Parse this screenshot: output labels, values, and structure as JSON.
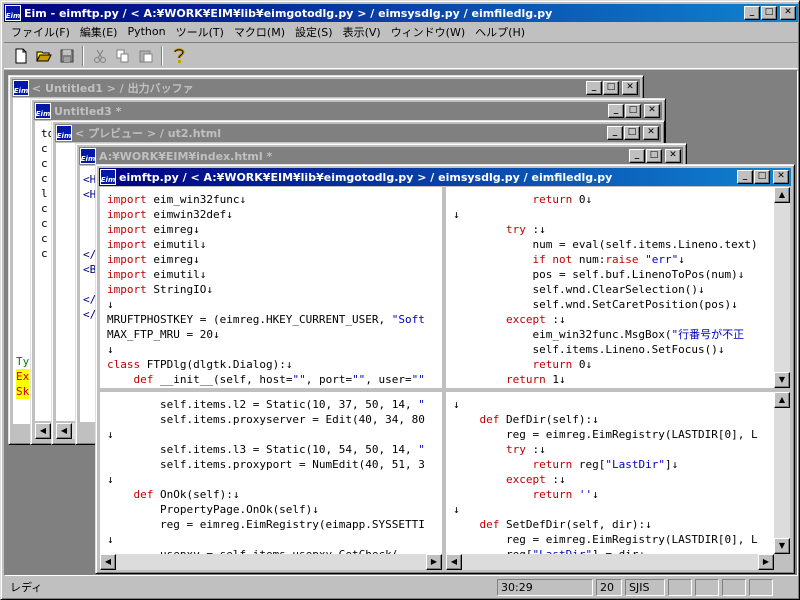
{
  "app": {
    "title": "Eim - eimftp.py / < A:¥WORK¥EIM¥lib¥eimgotodlg.py > / eimsysdlg.py / eimfiledlg.py",
    "icon": "Eim"
  },
  "menu": [
    "ファイル(F)",
    "編集(E)",
    "Python",
    "ツール(T)",
    "マクロ(M)",
    "設定(S)",
    "表示(V)",
    "ウィンドウ(W)",
    "ヘルプ(H)"
  ],
  "toolbar": {
    "icons": [
      "new-file-icon",
      "open-folder-icon",
      "save-icon",
      "cut-icon",
      "copy-icon",
      "paste-icon",
      "help-icon"
    ]
  },
  "windows": {
    "w1": "< Untitled1 > / 出力バッファ",
    "w2": "Untitled3 *",
    "w3": "< プレビュー > / ut2.html",
    "w4": "A:¥WORK¥EIM¥index.html *",
    "w5": "eimftp.py / < A:¥WORK¥EIM¥lib¥eimgotodlg.py > / eimsysdlg.py / eimfiledlg.py"
  },
  "bg_text": {
    "w1_lines": [
      "Ty",
      "Ex",
      "Sk"
    ],
    "w2_lines": [
      "to",
      "c",
      "c",
      "c",
      "l",
      "c",
      "c",
      "c",
      "c"
    ],
    "w4_lines": [
      "<H",
      "<H",
      "",
      "",
      "",
      "</",
      "<B",
      "",
      "</",
      "</"
    ]
  },
  "pane_tl": [
    [
      [
        "kw",
        "import"
      ],
      [
        "",
        "eim_win32func↓"
      ]
    ],
    [
      [
        "kw",
        "import"
      ],
      [
        "",
        "eimwin32def↓"
      ]
    ],
    [
      [
        "kw",
        "import"
      ],
      [
        "",
        "eimreg↓"
      ]
    ],
    [
      [
        "kw",
        "import"
      ],
      [
        "",
        "eimutil↓"
      ]
    ],
    [
      [
        "kw",
        "import"
      ],
      [
        "",
        "eimreg↓"
      ]
    ],
    [
      [
        "kw",
        "import"
      ],
      [
        "",
        "eimutil↓"
      ]
    ],
    [
      [
        "kw",
        "import"
      ],
      [
        "",
        "StringIO↓"
      ]
    ],
    [
      [
        "",
        "↓"
      ]
    ],
    [
      [
        "",
        "MRUFTPHOSTKEY = (eimreg.HKEY_CURRENT_USER, "
      ],
      [
        "st",
        "\"Soft"
      ]
    ],
    [
      [
        "",
        "MAX_FTP_MRU = 20↓"
      ]
    ],
    [
      [
        "",
        "↓"
      ]
    ],
    [
      [
        "kw",
        "class"
      ],
      [
        "",
        "FTPDlg(dlgtk.Dialog):↓"
      ]
    ],
    [
      [
        "",
        "    "
      ],
      [
        "kw",
        "def"
      ],
      [
        "",
        "__init__(self, host="
      ],
      [
        "st",
        "\"\""
      ],
      [
        "",
        ", port="
      ],
      [
        "st",
        "\"\""
      ],
      [
        "",
        ", user="
      ],
      [
        "st",
        "\"\""
      ]
    ]
  ],
  "pane_tr": [
    [
      [
        "",
        "            "
      ],
      [
        "kw",
        "return"
      ],
      [
        "",
        "0↓"
      ]
    ],
    [
      [
        "",
        "↓"
      ]
    ],
    [
      [
        "",
        "        "
      ],
      [
        "kw",
        "try"
      ],
      [
        "",
        ":↓"
      ]
    ],
    [
      [
        "",
        "            num = eval(self.items.Lineno.text)"
      ]
    ],
    [
      [
        "",
        "            "
      ],
      [
        "kw",
        "if not"
      ],
      [
        "",
        "num:"
      ],
      [
        "kw",
        "raise"
      ],
      [
        "st",
        "\"err\""
      ],
      [
        "",
        "↓"
      ]
    ],
    [
      [
        "",
        "            pos = self.buf.LinenoToPos(num)↓"
      ]
    ],
    [
      [
        "",
        "            self.wnd.ClearSelection()↓"
      ]
    ],
    [
      [
        "",
        "            self.wnd.SetCaretPosition(pos)↓"
      ]
    ],
    [
      [
        "",
        "        "
      ],
      [
        "kw",
        "except"
      ],
      [
        "",
        ":↓"
      ]
    ],
    [
      [
        "",
        "            eim_win32func.MsgBox("
      ],
      [
        "st",
        "\"行番号が不正"
      ]
    ],
    [
      [
        "",
        "            self.items.Lineno.SetFocus()↓"
      ]
    ],
    [
      [
        "",
        "            "
      ],
      [
        "kw",
        "return"
      ],
      [
        "",
        "0↓"
      ]
    ],
    [
      [
        "",
        "        "
      ],
      [
        "kw",
        "return"
      ],
      [
        "",
        "1↓"
      ]
    ]
  ],
  "pane_bl": [
    [
      [
        "",
        "        self.items.l2 = Static(10, 37, 50, 14, "
      ],
      [
        "st",
        "\""
      ]
    ],
    [
      [
        "",
        "        self.items.proxyserver = Edit(40, 34, 80"
      ]
    ],
    [
      [
        "",
        "↓"
      ]
    ],
    [
      [
        "",
        "        self.items.l3 = Static(10, 54, 50, 14, "
      ],
      [
        "st",
        "\""
      ]
    ],
    [
      [
        "",
        "        self.items.proxyport = NumEdit(40, 51, 3"
      ]
    ],
    [
      [
        "",
        "↓"
      ]
    ],
    [
      [
        "",
        "    "
      ],
      [
        "kw",
        "def"
      ],
      [
        "",
        "OnOk(self):↓"
      ]
    ],
    [
      [
        "",
        "        PropertyPage.OnOk(self)↓"
      ]
    ],
    [
      [
        "",
        "        reg = eimreg.EimRegistry(eimapp.SYSSETTI"
      ]
    ],
    [
      [
        "",
        "↓"
      ]
    ],
    [
      [
        "",
        "        usepxy = self.items.usepxy.GetCheck("
      ]
    ]
  ],
  "pane_br": [
    [
      [
        "",
        "↓"
      ]
    ],
    [
      [
        "",
        "    "
      ],
      [
        "kw",
        "def"
      ],
      [
        "",
        "DefDir(self):↓"
      ]
    ],
    [
      [
        "",
        "        reg = eimreg.EimRegistry(LASTDIR[0], L"
      ]
    ],
    [
      [
        "",
        "        "
      ],
      [
        "kw",
        "try"
      ],
      [
        "",
        ":↓"
      ]
    ],
    [
      [
        "",
        "            "
      ],
      [
        "kw",
        "return"
      ],
      [
        "",
        "reg["
      ],
      [
        "st",
        "\"LastDir\""
      ],
      [
        "",
        "]↓"
      ]
    ],
    [
      [
        "",
        "        "
      ],
      [
        "kw",
        "except"
      ],
      [
        "",
        ":↓"
      ]
    ],
    [
      [
        "",
        "            "
      ],
      [
        "kw",
        "return"
      ],
      [
        "st",
        "''"
      ],
      [
        "",
        "↓"
      ]
    ],
    [
      [
        "",
        "↓"
      ]
    ],
    [
      [
        "",
        "    "
      ],
      [
        "kw",
        "def"
      ],
      [
        "",
        "SetDefDir(self, dir):↓"
      ]
    ],
    [
      [
        "",
        "        reg = eimreg.EimRegistry(LASTDIR[0], L"
      ]
    ],
    [
      [
        "",
        "        reg["
      ],
      [
        "st",
        "\"LastDir\""
      ],
      [
        "",
        "] = dir↓"
      ]
    ]
  ],
  "status": {
    "mode": "レディ",
    "position": "30:29",
    "column": "20",
    "encoding": "SJIS"
  }
}
